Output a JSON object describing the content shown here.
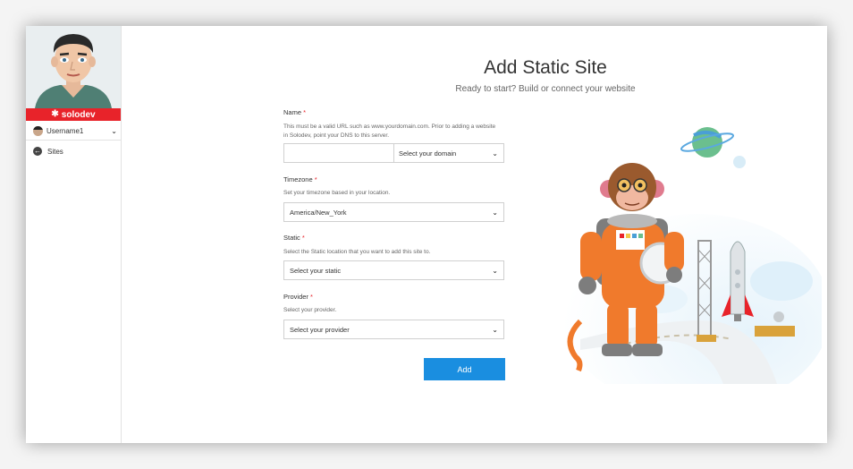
{
  "sidebar": {
    "brand": "solodev",
    "username": "Username1",
    "nav": [
      {
        "label": "Sites"
      }
    ]
  },
  "header": {
    "title": "Add Static Site",
    "subtitle": "Ready to start? Build or connect your website"
  },
  "form": {
    "name": {
      "label": "Name",
      "required": "*",
      "help": "This must be a valid URL such as www.yourdomain.com. Prior to adding a website in Solodev, point your DNS to this server.",
      "value": "",
      "domain_placeholder": "Select your domain"
    },
    "timezone": {
      "label": "Timezone",
      "required": "*",
      "help": "Set your timezone based in your location.",
      "value": "America/New_York"
    },
    "static": {
      "label": "Static",
      "required": "*",
      "help": "Select the Static location that you want to add this site to.",
      "value": "Select your static"
    },
    "provider": {
      "label": "Provider",
      "required": "*",
      "help": "Select your provider.",
      "value": "Select your provider"
    },
    "submit_label": "Add"
  },
  "colors": {
    "brand_red": "#e8232a",
    "button_blue": "#1a8ee0",
    "astronaut_orange": "#f07a2c"
  },
  "icons": [
    "chevron-down-icon",
    "back-arrow-icon",
    "solodev-star-icon"
  ]
}
